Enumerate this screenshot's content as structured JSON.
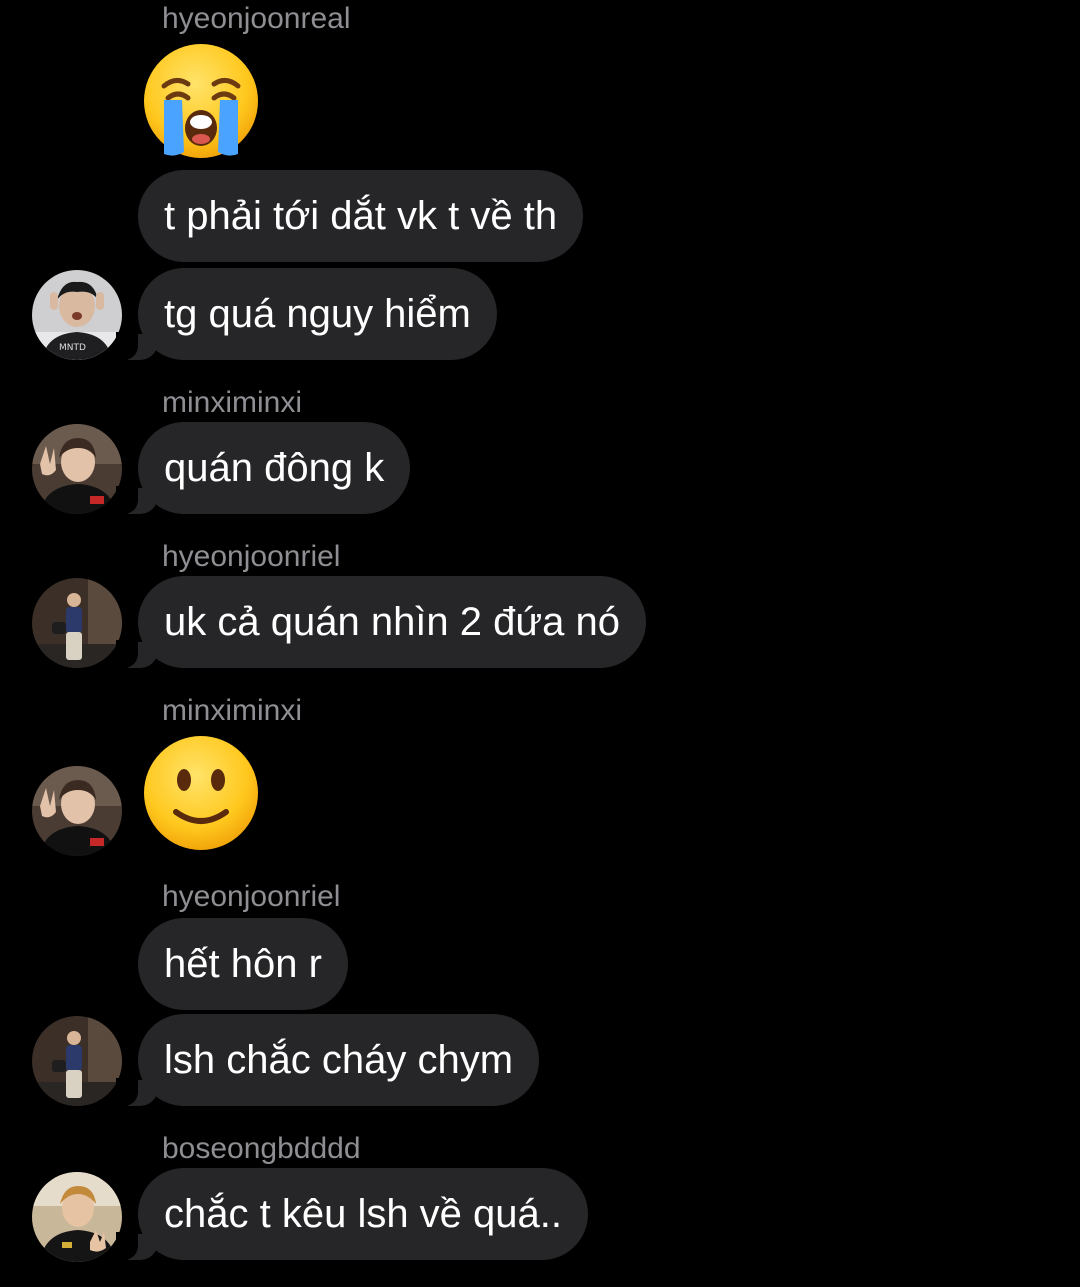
{
  "chat": {
    "messages": [
      {
        "sender": "hyeonjoonreal"
      },
      {
        "text": "t phải tới dắt vk t về th"
      },
      {
        "text": "tg quá nguy hiểm"
      },
      {
        "sender": "minximinxi",
        "text": "quán đông k"
      },
      {
        "sender": "hyeonjoonriel",
        "text": "uk cả quán nhìn 2 đứa nó"
      },
      {
        "sender": "minximinxi"
      },
      {
        "sender": "hyeonjoonriel",
        "text": "hết hôn r"
      },
      {
        "text": "lsh chắc cháy chym"
      },
      {
        "sender": "boseongbdddd",
        "text": "chắc t kêu lsh về quá.."
      }
    ]
  },
  "emojis": {
    "first": "loudly-crying-face",
    "second": "slightly-smiling-face"
  },
  "colors": {
    "background": "#000000",
    "bubble": "#262628",
    "sender_name": "#8e8e93",
    "message_text": "#ffffff"
  }
}
